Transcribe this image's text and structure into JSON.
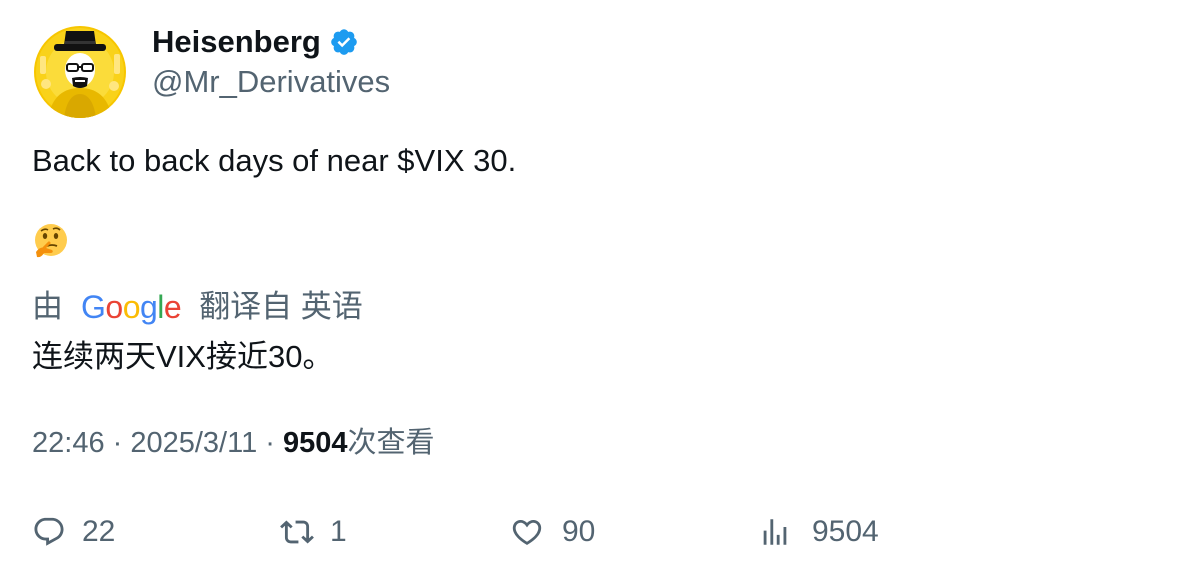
{
  "author": {
    "display_name": "Heisenberg",
    "handle": "@Mr_Derivatives",
    "verified": true,
    "verified_color": "#1d9bf0",
    "avatar_icon": "heisenberg-avatar",
    "avatar_bg": "#f7c600"
  },
  "tweet": {
    "text": "Back to back days of near $VIX 30.",
    "emoji": "🤔"
  },
  "translation": {
    "prefix": "由",
    "provider": "Google",
    "suffix": "翻译自 英语",
    "text": "连续两天VIX接近30。"
  },
  "meta": {
    "time": "22:46",
    "separator1": " · ",
    "date": "2025/3/11",
    "separator2": " · ",
    "views_count": "9504",
    "views_label": "次查看"
  },
  "actions": {
    "reply": "22",
    "retweet": "1",
    "like": "90",
    "views": "9504"
  },
  "colors": {
    "text_primary": "#0f1419",
    "text_secondary": "#536471"
  }
}
